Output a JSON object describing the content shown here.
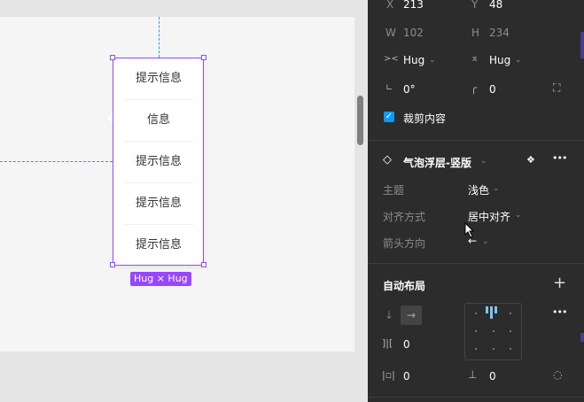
{
  "canvas": {
    "popover_items": [
      "提示信息",
      "信息",
      "提示信息",
      "提示信息",
      "提示信息"
    ],
    "size_badge": "Hug × Hug"
  },
  "panel": {
    "x_label": "X",
    "x_value": "213",
    "y_label": "Y",
    "y_value": "48",
    "w_label": "W",
    "w_value": "102",
    "h_label": "H",
    "h_value": "234",
    "hug_h": "Hug",
    "hug_v": "Hug",
    "rotation": "0°",
    "radius": "0",
    "clip_label": "裁剪内容",
    "component_name": "气泡浮层-竖版",
    "props": [
      {
        "label": "主题",
        "value": "浅色"
      },
      {
        "label": "对齐方式",
        "value": "居中对齐"
      },
      {
        "label": "箭头方向",
        "value": "←"
      }
    ],
    "auto_layout_title": "自动布局",
    "add_symbol": "+",
    "gap_value": "0",
    "padding_h_value": "0",
    "padding_v_value": "0",
    "more_symbol": "•••"
  },
  "icons": {
    "arrow_down": "↓",
    "arrow_right": "→",
    "check": "✓",
    "diamond": "◇",
    "chevron": "⌄"
  }
}
